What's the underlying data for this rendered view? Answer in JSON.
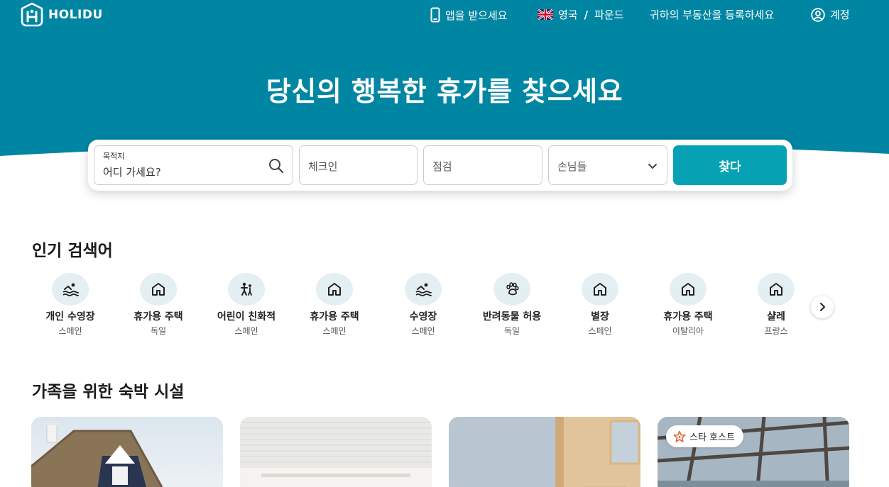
{
  "brand": {
    "name": "HOLIDU"
  },
  "colors": {
    "hero": "#0086a3",
    "primary_button": "#06a2b3",
    "icon_bg": "#e3eff2",
    "star": "#e8622c"
  },
  "nav": {
    "app_label": "앱을 받으세요",
    "country": "영국",
    "separator": "/",
    "currency": "파운드",
    "list_property": "귀하의 부동산을 등록하세요",
    "account": "계정"
  },
  "hero": {
    "title": "당신의 행복한 휴가를 찾으세요"
  },
  "search": {
    "destination_label": "목적지",
    "destination_placeholder": "어디 가세요?",
    "checkin": "체크인",
    "checkout": "점검",
    "guests": "손님들",
    "button": "찾다"
  },
  "popular": {
    "title": "인기 검색어",
    "items": [
      {
        "icon": "swimming-icon",
        "title": "개인 수영장",
        "subtitle": "스페인"
      },
      {
        "icon": "house-icon",
        "title": "휴가용 주택",
        "subtitle": "독일"
      },
      {
        "icon": "kids-icon",
        "title": "어린이 친화적",
        "subtitle": "스페인"
      },
      {
        "icon": "house-icon",
        "title": "휴가용 주택",
        "subtitle": "스페인"
      },
      {
        "icon": "swimming-icon",
        "title": "수영장",
        "subtitle": "스페인"
      },
      {
        "icon": "paw-icon",
        "title": "반려동물 허용",
        "subtitle": "독일"
      },
      {
        "icon": "house-icon",
        "title": "별장",
        "subtitle": "스페인"
      },
      {
        "icon": "house-icon",
        "title": "휴가용 주택",
        "subtitle": "이탈리아"
      },
      {
        "icon": "house-icon",
        "title": "샬레",
        "subtitle": "프랑스"
      }
    ]
  },
  "family": {
    "title": "가족을 위한 숙박 시설",
    "badge": "스타 호스트"
  }
}
